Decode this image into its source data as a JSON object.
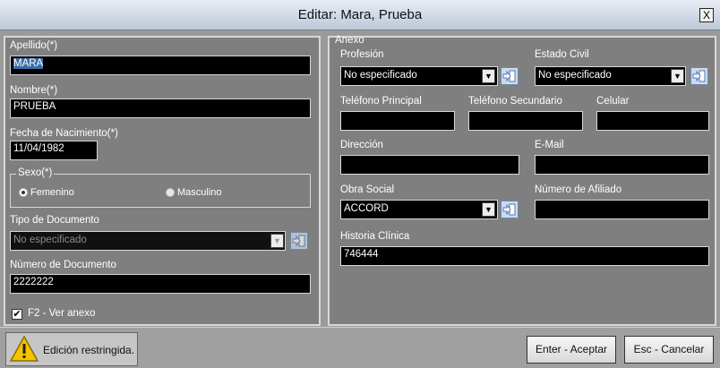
{
  "window": {
    "title": "Editar: Mara, Prueba",
    "close_glyph": "X"
  },
  "left": {
    "apellido": {
      "label": "Apellido(*)",
      "value": "MARA"
    },
    "nombre": {
      "label": "Nombre(*)",
      "value": "PRUEBA"
    },
    "fecha": {
      "label": "Fecha de Nacimiento(*)",
      "value": "11/04/1982"
    },
    "sexo": {
      "legend": "Sexo(*)",
      "options": [
        "Femenino",
        "Masculino"
      ],
      "selected": "Femenino"
    },
    "tipo_doc": {
      "label": "Tipo de Documento",
      "value": "No especificado"
    },
    "num_doc": {
      "label": "Número de Documento",
      "value": "2222222"
    },
    "ver_anexo": {
      "label": "F2 - Ver anexo",
      "checked": true
    }
  },
  "anexo": {
    "legend": "Anexo",
    "profesion": {
      "label": "Profesión",
      "value": "No especificado"
    },
    "estado_civil": {
      "label": "Estado Civil",
      "value": "No especificado"
    },
    "tel_principal": {
      "label": "Teléfono Principal",
      "value": ""
    },
    "tel_secundario": {
      "label": "Teléfono Secundario",
      "value": ""
    },
    "celular": {
      "label": "Celular",
      "value": ""
    },
    "direccion": {
      "label": "Dirección",
      "value": ""
    },
    "email": {
      "label": "E-Mail",
      "value": ""
    },
    "obra_social": {
      "label": "Obra Social",
      "value": "ACCORD"
    },
    "num_afiliado": {
      "label": "Número de Afiliado",
      "value": ""
    },
    "historia": {
      "label": "Historia Clínica",
      "value": "746444"
    }
  },
  "footer": {
    "warning": "Edición restringida.",
    "accept": "Enter - Aceptar",
    "cancel": "Esc - Cancelar"
  },
  "colors": {
    "accent_selection": "#3a6ea5",
    "field_bg": "#000000",
    "panel_bg": "#7f7f7f"
  }
}
